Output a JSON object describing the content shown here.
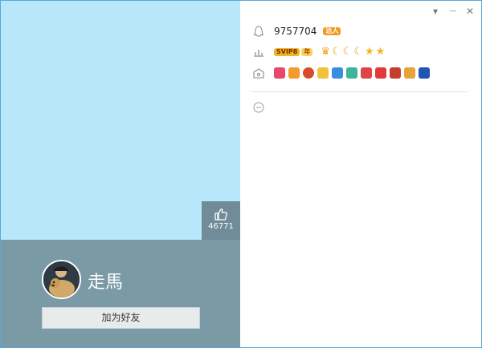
{
  "window": {
    "accent": "#5aa7d8",
    "controls": [
      {
        "name": "dropdown",
        "glyph": "▾"
      },
      {
        "name": "minimize",
        "glyph": "—"
      },
      {
        "name": "close",
        "glyph": "✕"
      }
    ]
  },
  "profile": {
    "cover_color": "#b9e7fa",
    "panel_color": "#7a9aa6",
    "username": "走馬",
    "likes": "46771",
    "add_friend_label": "加为好友"
  },
  "info": {
    "qq_number": "9757704",
    "daren_badge": "达人",
    "vip_label": "SVIP8",
    "vip_year": "年",
    "level_icons": [
      "crown",
      "moon",
      "moon",
      "moon",
      "star",
      "star"
    ],
    "service_icons": [
      "heart-wing-icon",
      "gift-bag-icon",
      "game-icon",
      "music-icon",
      "star-blue-icon",
      "wallet-icon",
      "video-icon",
      "down-arrow-icon",
      "car-icon",
      "feather-icon",
      "pet-icon"
    ]
  }
}
